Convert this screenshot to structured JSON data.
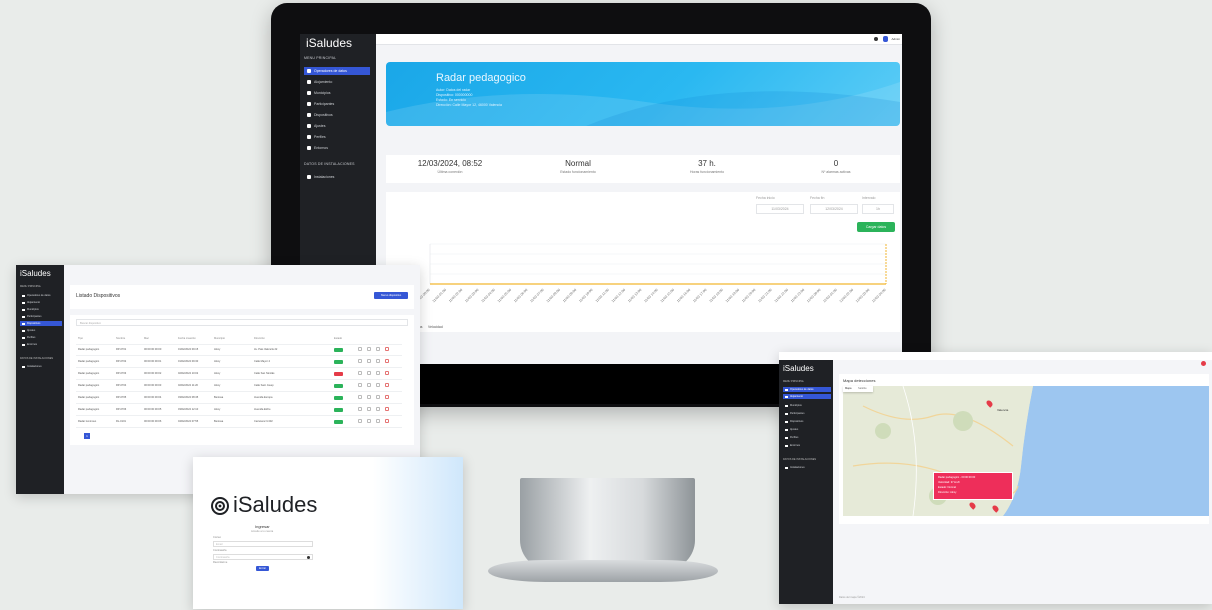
{
  "brand": "iSaludes",
  "main_dashboard": {
    "sidebar": {
      "section_main": "MENU PRINCIPAL",
      "items": [
        {
          "label": "Operadores de datos",
          "icon": "home-icon",
          "active": true
        },
        {
          "label": "Alojamiento",
          "icon": "hotel-icon"
        },
        {
          "label": "Municipios",
          "icon": "map-icon"
        },
        {
          "label": "Participantes",
          "icon": "users-icon"
        },
        {
          "label": "Dispositivos",
          "icon": "device-icon"
        },
        {
          "label": "Ajustes",
          "icon": "settings-icon"
        },
        {
          "label": "Perfiles",
          "icon": "profile-icon"
        },
        {
          "label": "Entornos",
          "icon": "env-icon"
        }
      ],
      "section_secondary": "DATOS DE INSTALACIONES",
      "secondary_items": [
        {
          "label": "Instalaciones",
          "icon": "building-icon"
        }
      ]
    },
    "topbar": {
      "user_label": "Admin"
    },
    "hero": {
      "title": "Radar pedagogico",
      "lines": [
        "Autor: Datos del radar",
        "Dispositivo: 000000000",
        "Estado: En servicio",
        "Dirección: Calle Mayor 12, 46000 Valencia"
      ]
    },
    "stats": [
      {
        "value": "12/03/2024, 08:52",
        "label": "Última conexión"
      },
      {
        "value": "Normal",
        "label": "Estado funcionamiento"
      },
      {
        "value": "37 h.",
        "label": "Horas funcionamiento"
      },
      {
        "value": "0",
        "label": "Nº alarmas activas"
      }
    ],
    "filters": [
      {
        "label": "Fecha inicio",
        "value": "11/03/2024"
      },
      {
        "label": "Fecha fin",
        "value": "12/03/2024"
      },
      {
        "label": "Intervalo",
        "value": "1h"
      }
    ],
    "apply_button": "Cargar datos",
    "chart_data": {
      "type": "line",
      "x": [
        "11/03 00:00",
        "11/03 01:00",
        "11/03 02:00",
        "11/03 03:00",
        "11/03 04:00",
        "11/03 05:00",
        "11/03 06:00",
        "11/03 07:00",
        "11/03 08:00",
        "11/03 09:00",
        "11/03 10:00",
        "11/03 11:00",
        "11/03 12:00",
        "11/03 13:00",
        "11/03 14:00",
        "11/03 15:00",
        "11/03 16:00",
        "11/03 17:00",
        "11/03 18:00",
        "11/03 19:00",
        "11/03 20:00",
        "11/03 21:00",
        "11/03 22:00",
        "11/03 23:00",
        "12/03 00:00",
        "12/03 01:00",
        "12/03 02:00",
        "12/03 03:00",
        "12/03 04:00"
      ],
      "series": [
        {
          "name": "Velocidad",
          "color": "#f2b632",
          "values": [
            0,
            0,
            0,
            0,
            0,
            0,
            0,
            0,
            0,
            0,
            0,
            0,
            0,
            0,
            0,
            0,
            0,
            0,
            0,
            0,
            0,
            0,
            0,
            0,
            0,
            0,
            0,
            0,
            0
          ]
        }
      ],
      "ylim": [
        0,
        40
      ],
      "grid": true,
      "legend": "bottom",
      "legend_items": [
        "Alarmas",
        "Velocidad"
      ]
    }
  },
  "devices_list": {
    "title": "Listado Dispositivos",
    "new_button": "Nuevo dispositivo",
    "search_placeholder": "Buscar dispositivo",
    "columns": [
      "Tipo",
      "Nombre",
      "Mac",
      "Fecha creación",
      "Municipio",
      "Dirección",
      "Estado"
    ],
    "rows": [
      {
        "type": "Radar pedagogico",
        "name": "RP-0701",
        "mac": "00:00:00:00:00",
        "date": "01/02/2024 09:15",
        "municipio": "Alcoy",
        "address": "Av. Pais Valencià 22",
        "status": "green"
      },
      {
        "type": "Radar pedagogico",
        "name": "RP-0702",
        "mac": "00:00:00:00:01",
        "date": "01/02/2024 09:30",
        "municipio": "Alcoy",
        "address": "Calle Mayor 4",
        "status": "green"
      },
      {
        "type": "Radar pedagogico",
        "name": "RP-0703",
        "mac": "00:00:00:00:02",
        "date": "02/02/2024 10:02",
        "municipio": "Alcoy",
        "address": "Calle San Nicolás",
        "status": "red"
      },
      {
        "type": "Radar pedagogico",
        "name": "RP-0704",
        "mac": "00:00:00:00:03",
        "date": "02/02/2024 11:20",
        "municipio": "Alcoy",
        "address": "Calle Sant Josep",
        "status": "green"
      },
      {
        "type": "Radar pedagogico",
        "name": "RP-0705",
        "mac": "00:00:00:00:04",
        "date": "03/02/2024 08:45",
        "municipio": "Benissa",
        "address": "Avenida Europa",
        "status": "green"
      },
      {
        "type": "Radar pedagogico",
        "name": "RP-0706",
        "mac": "00:00:00:00:05",
        "date": "03/02/2024 12:10",
        "municipio": "Alcoy",
        "address": "Avenida Elche",
        "status": "green"
      },
      {
        "type": "Radar luminoso",
        "name": "RL-0101",
        "mac": "00:00:00:00:06",
        "date": "04/02/2024 07:55",
        "municipio": "Benissa",
        "address": "Carretera N-332",
        "status": "green"
      }
    ],
    "pagination": [
      "1"
    ]
  },
  "login": {
    "brand": "iSaludes",
    "title": "Ingresar",
    "subtitle": "Accede a tu cuenta",
    "email_label": "Correo",
    "email_placeholder": "Email",
    "password_label": "Contraseña",
    "password_placeholder": "Contraseña",
    "remember_label": "Recordarme",
    "submit": "Entrar"
  },
  "map_view": {
    "title": "Mapa detecciones",
    "tabs": [
      "Mapa",
      "Satélite"
    ],
    "city_label": "Valencia",
    "popup_lines": [
      "Radar pedagogico - 00:00:00:00",
      "Velocidad: 37 km/h",
      "Estado: Normal",
      "Dirección: Alcoy"
    ],
    "footer": "Datos del mapa ©2024"
  }
}
